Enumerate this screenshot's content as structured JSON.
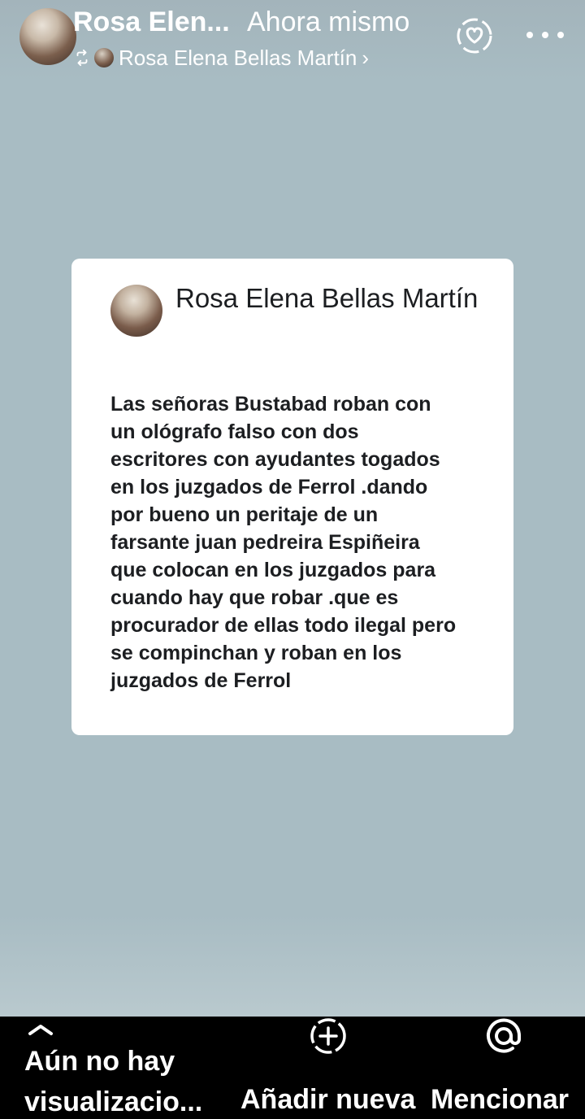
{
  "header": {
    "author_name": "Rosa Elen...",
    "timestamp": "Ahora mismo",
    "shared_from": "Rosa Elena Bellas Martín",
    "share_icon": "repost-icon",
    "reaction_icon": "heart-sparkle-icon",
    "more_icon": "more-icon",
    "chevron": "›"
  },
  "post": {
    "author": "Rosa Elena Bellas Martín",
    "text": "Las señoras Bustabad roban  con\nun ológrafo falso con dos\nescritores con ayudantes togados\nen los juzgados de Ferrol .dando\npor bueno un peritaje de un\nfarsante juan pedreira Espiñeira\nque colocan en los juzgados  para\ncuando hay que robar .que es\nprocurador de ellas todo ilegal pero\nse compinchan y roban en los\njuzgados de Ferrol"
  },
  "bottom_bar": {
    "views_label": "Aún no hay\nvisualizacio...",
    "add_label": "Añadir nueva",
    "mention_label": "Mencionar"
  },
  "colors": {
    "background": "#a8bcc3",
    "card": "#ffffff",
    "bar": "#000000",
    "text_dark": "#1c1e21"
  }
}
